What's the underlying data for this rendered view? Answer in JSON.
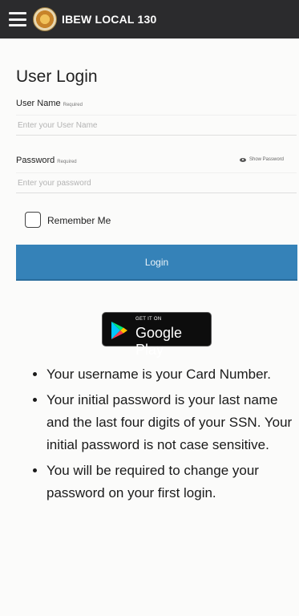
{
  "header": {
    "app_title": "IBEW LOCAL 130",
    "menu_icon": "hamburger-menu-icon",
    "logo_icon": "union-seal-logo"
  },
  "form": {
    "title": "User Login",
    "username": {
      "label": "User Name",
      "required_tag": "Required",
      "placeholder": "Enter your User Name",
      "value": ""
    },
    "password": {
      "label": "Password",
      "required_tag": "Required",
      "placeholder": "Enter your password",
      "value": "",
      "show_password_label": "Show Password",
      "show_password_icon": "eye-icon"
    },
    "remember_me": {
      "label": "Remember Me",
      "checked": false
    },
    "login_button": "Login"
  },
  "store_badge": {
    "small_text": "GET IT ON",
    "big_text": "Google Play",
    "icon": "google-play-icon"
  },
  "notes": [
    "Your username is your Card Number.",
    "Your initial password is your last name and the last four digits of your SSN. Your initial password is not case sensitive.",
    "You will be required to change your password on your first login."
  ],
  "colors": {
    "topbar": "#2b2b2d",
    "button": "#3582b8",
    "background": "#fbfbfa"
  }
}
